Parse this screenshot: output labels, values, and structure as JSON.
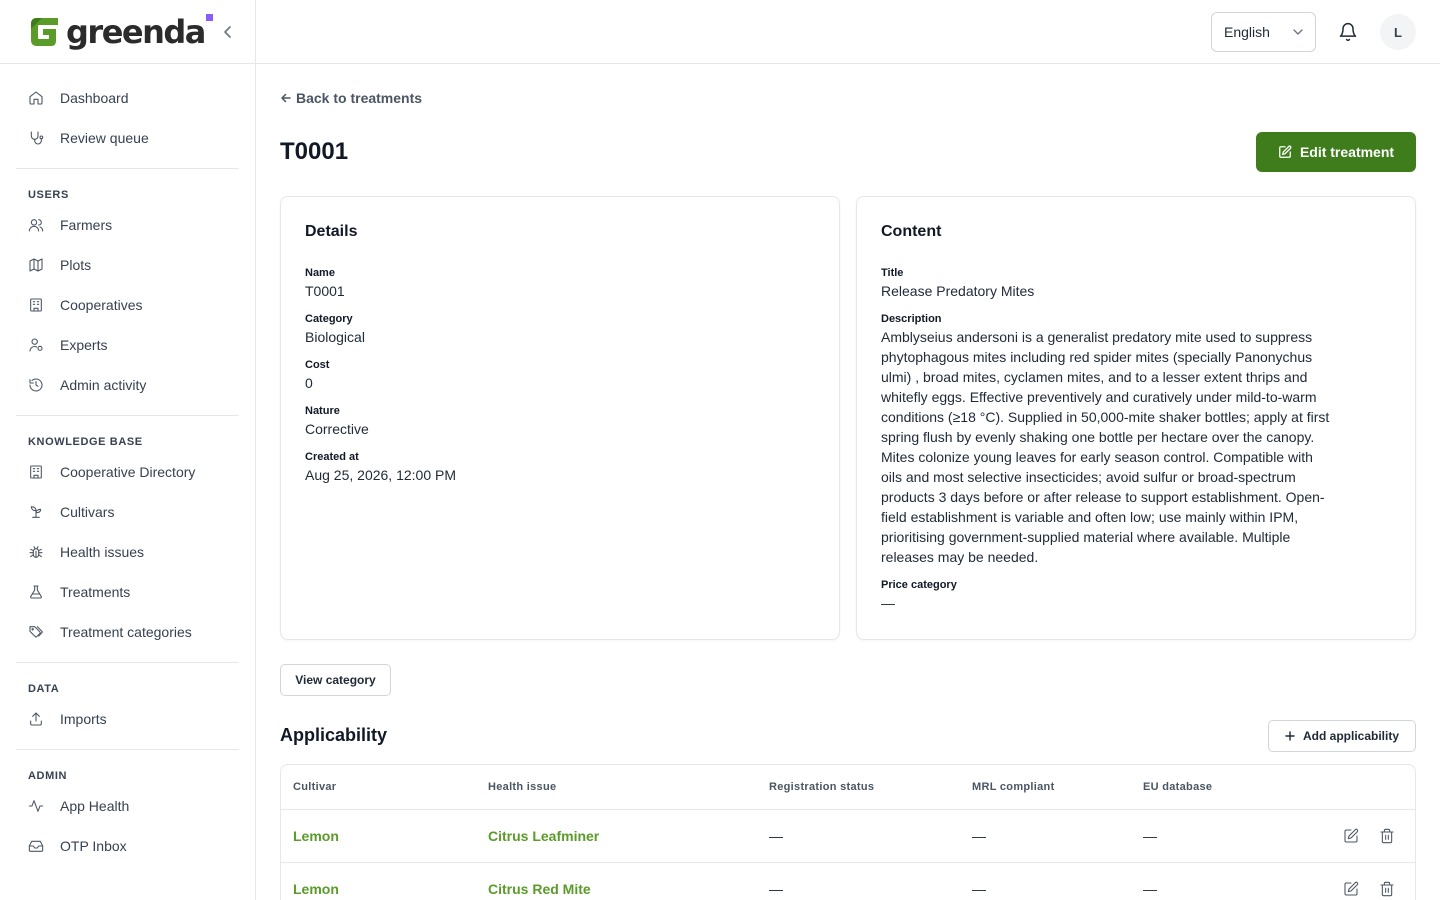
{
  "brand": {
    "name": "greenda",
    "accent": "#3f7d1c",
    "dot_color": "#8b5cf6"
  },
  "sidebar": {
    "top_items": [
      {
        "label": "Dashboard",
        "icon": "home-icon"
      },
      {
        "label": "Review queue",
        "icon": "stethoscope-icon"
      }
    ],
    "groups": [
      {
        "heading": "USERS",
        "items": [
          {
            "label": "Farmers",
            "icon": "users-icon"
          },
          {
            "label": "Plots",
            "icon": "map-icon"
          },
          {
            "label": "Cooperatives",
            "icon": "building-icon"
          },
          {
            "label": "Experts",
            "icon": "user-cog-icon"
          },
          {
            "label": "Admin activity",
            "icon": "history-icon"
          }
        ]
      },
      {
        "heading": "KNOWLEDGE BASE",
        "items": [
          {
            "label": "Cooperative Directory",
            "icon": "building-icon"
          },
          {
            "label": "Cultivars",
            "icon": "sprout-icon"
          },
          {
            "label": "Health issues",
            "icon": "bug-icon"
          },
          {
            "label": "Treatments",
            "icon": "flask-icon"
          },
          {
            "label": "Treatment categories",
            "icon": "tags-icon"
          }
        ]
      },
      {
        "heading": "DATA",
        "items": [
          {
            "label": "Imports",
            "icon": "upload-icon"
          }
        ]
      },
      {
        "heading": "ADMIN",
        "items": [
          {
            "label": "App Health",
            "icon": "activity-icon"
          },
          {
            "label": "OTP Inbox",
            "icon": "inbox-icon"
          }
        ]
      }
    ]
  },
  "topbar": {
    "language": "English",
    "avatar_initial": "L"
  },
  "page": {
    "back_label": "Back to treatments",
    "title": "T0001",
    "edit_label": "Edit treatment",
    "view_category_label": "View category"
  },
  "details": {
    "heading": "Details",
    "fields": [
      {
        "label": "Name",
        "value": "T0001"
      },
      {
        "label": "Category",
        "value": "Biological"
      },
      {
        "label": "Cost",
        "value": "0"
      },
      {
        "label": "Nature",
        "value": "Corrective"
      },
      {
        "label": "Created at",
        "value": "Aug 25, 2026, 12:00 PM"
      }
    ]
  },
  "content": {
    "heading": "Content",
    "title_label": "Title",
    "title_value": "Release Predatory Mites",
    "description_label": "Description",
    "description_lines": [
      "Amblyseius andersoni is a generalist predatory mite used to suppress",
      "phytophagous mites including red spider mites (specially Panonychus",
      "ulmi) , broad mites, cyclamen mites, and to a lesser extent thrips and",
      "whitefly eggs. Effective preventively and curatively under mild-to-warm",
      "conditions (≥18 °C). Supplied in 50,000-mite shaker bottles; apply at first",
      "spring flush by evenly shaking one bottle per hectare over the canopy.",
      "Mites colonize young leaves for early season control. Compatible with",
      "oils and most selective insecticides; avoid sulfur or broad-spectrum",
      "products 3 days before or after release to support establishment. Open-",
      "field establishment is variable and often low; use mainly within IPM,",
      "prioritising government-supplied material where available. Multiple",
      "releases may be needed."
    ],
    "price_label": "Price category",
    "price_value": "—"
  },
  "applicability": {
    "heading": "Applicability",
    "add_label": "Add applicability",
    "columns": [
      "Cultivar",
      "Health issue",
      "Registration status",
      "MRL compliant",
      "EU database"
    ],
    "rows": [
      {
        "cultivar": "Lemon",
        "health_issue": "Citrus Leafminer",
        "registration": "—",
        "mrl": "—",
        "eu": "—"
      },
      {
        "cultivar": "Lemon",
        "health_issue": "Citrus Red Mite",
        "registration": "—",
        "mrl": "—",
        "eu": "—"
      }
    ]
  }
}
